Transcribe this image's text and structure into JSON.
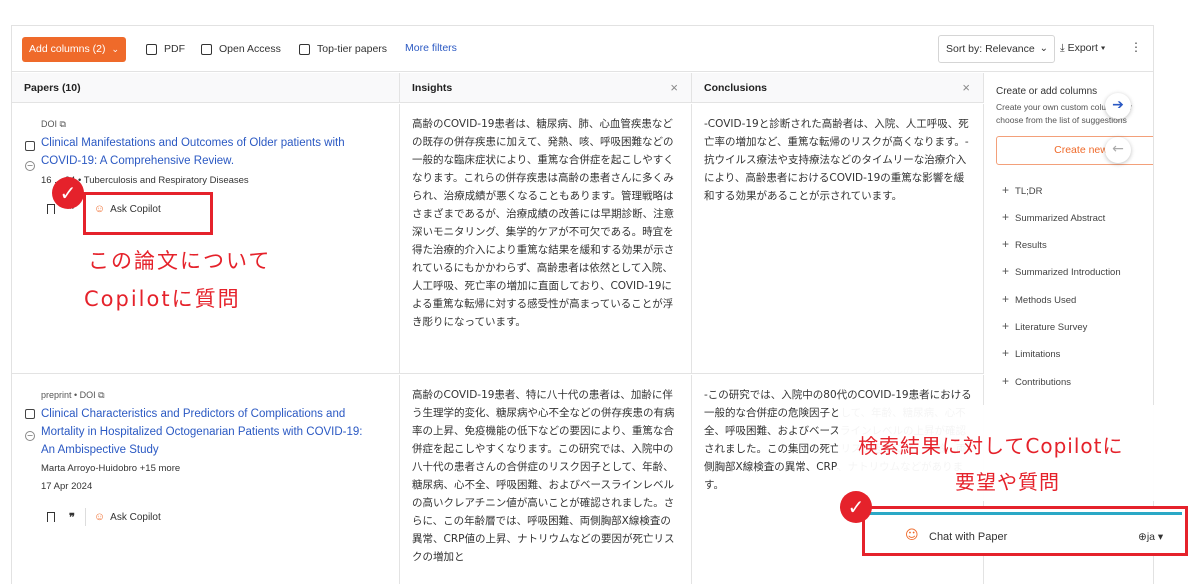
{
  "toolbar": {
    "add_columns": "Add columns (2)",
    "filters": [
      "PDF",
      "Open Access",
      "Top-tier papers"
    ],
    "more_filters": "More filters",
    "sort": "Sort by: Relevance",
    "export": "Export"
  },
  "columns": {
    "papers": "Papers (10)",
    "insights": "Insights",
    "conclusions": "Conclusions"
  },
  "rows": [
    {
      "source": "DOI",
      "title_lines": [
        "Clinical Manifestations and Outcomes of Older patients with",
        "COVID-19: A Comprehensive Review."
      ],
      "meta": "16 ... 24 • Tuberculosis and Respiratory Diseases",
      "ask_copilot": "Ask Copilot",
      "insight": "高齢のCOVID-19患者は、糖尿病、肺、心血管疾患などの既存の併存疾患に加えて、発熱、咳、呼吸困難などの一般的な臨床症状により、重篤な合併症を起こしやすくなります。これらの併存疾患は高齢の患者さんに多くみられ、治療成績が悪くなることもあります。管理戦略はさまざまであるが、治療成績の改善には早期診断、注意深いモニタリング、集学的ケアが不可欠である。時宜を得た治療的介入により重篤な結果を緩和する効果が示されているにもかかわらず、高齢患者は依然として入院、人工呼吸、死亡率の増加に直面しており、COVID-19による重篤な転帰に対する感受性が高まっていることが浮き彫りになっています。",
      "conclusion": "-COVID-19と診断された高齢者は、入院、人工呼吸、死亡率の増加など、重篤な転帰のリスクが高くなります。-抗ウイルス療法や支持療法などのタイムリーな治療介入により、高齢患者におけるCOVID-19の重篤な影響を緩和する効果があることが示されています。"
    },
    {
      "source": "preprint • DOI",
      "title_lines": [
        "Clinical Characteristics and Predictors of Complications and",
        "Mortality in Hospitalized Octogenarian Patients with COVID-19:",
        "An Ambispective Study"
      ],
      "authors": "Marta Arroyo-Huidobro",
      "more_authors": "+15 more",
      "date": "17 Apr 2024",
      "ask_copilot": "Ask Copilot",
      "insight": "高齢のCOVID-19患者、特に八十代の患者は、加齢に伴う生理学的変化、糖尿病や心不全などの併存疾患の有病率の上昇、免疫機能の低下などの要因により、重篤な合併症を起こしやすくなります。この研究では、入院中の八十代の患者さんの合併症のリスク因子として、年齢、糖尿病、心不全、呼吸困難、およびベースラインレベルの高いクレアチニン値が高いことが確認されました。さらに、この年齢層では、呼吸困難、両側胸部X線検査の異常、CRP値の上昇、ナトリウムなどの要因が死亡リスクの増加と",
      "conclusion": "-この研究では、入院中の80代のCOVID-19患者における一般的な合併症の危険因子として、年齢、糖尿病、心不全、呼吸困難、およびベースラインレベルの上昇が確認されました。この集団の死亡リスク因子には、年齢、両側胸部X線検査の異常、CRP、ナトリウムなどがあります。"
    }
  ],
  "panel": {
    "title": "Create or add columns",
    "subtitle": "Create your own custom columns or choose from the list of suggestions",
    "create_new": "Create new",
    "suggestions": [
      "TL;DR",
      "Summarized Abstract",
      "Results",
      "Summarized Introduction",
      "Methods Used",
      "Literature Survey",
      "Limitations",
      "Contributions"
    ]
  },
  "annotations": {
    "left_text_line1": "この論文について",
    "left_text_line2": "Copilotに質問",
    "right_text_line1": "検索結果に対してCopilotに",
    "right_text_line2": "要望や質問"
  },
  "chat": {
    "label": "Chat with Paper",
    "lang": "ja"
  },
  "colors": {
    "accent": "#ef6a2a",
    "link": "#2b59c3",
    "annotation_red": "#e5222b",
    "chat_top_border": "#2aa8c6"
  }
}
